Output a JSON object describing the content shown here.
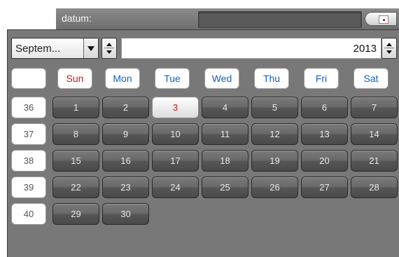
{
  "header": {
    "label": "datum:",
    "value": "",
    "calendar_icon": "calendar-icon"
  },
  "month_select": {
    "value": "Septem..."
  },
  "year": {
    "value": "2013"
  },
  "weekdays": [
    "Sun",
    "Mon",
    "Tue",
    "Wed",
    "Thu",
    "Fri",
    "Sat"
  ],
  "weeks": [
    {
      "number": "36",
      "days": [
        "1",
        "2",
        "3",
        "4",
        "5",
        "6",
        "7"
      ]
    },
    {
      "number": "37",
      "days": [
        "8",
        "9",
        "10",
        "11",
        "12",
        "13",
        "14"
      ]
    },
    {
      "number": "38",
      "days": [
        "15",
        "16",
        "17",
        "18",
        "19",
        "20",
        "21"
      ]
    },
    {
      "number": "39",
      "days": [
        "22",
        "23",
        "24",
        "25",
        "26",
        "27",
        "28"
      ]
    },
    {
      "number": "40",
      "days": [
        "29",
        "30"
      ]
    }
  ],
  "today": "3",
  "colors": {
    "sunday": "#c01818",
    "weekday": "#1060c0",
    "today": "#c01818"
  }
}
